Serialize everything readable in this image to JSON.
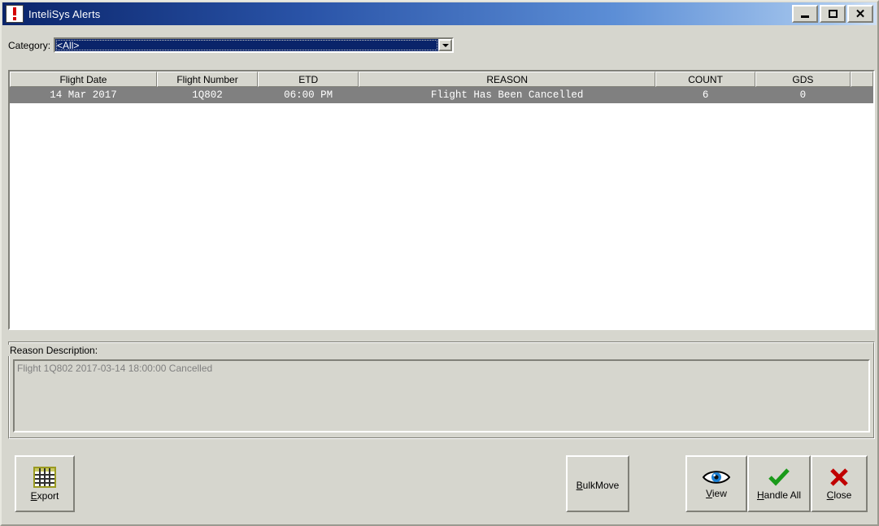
{
  "window": {
    "title": "InteliSys Alerts",
    "icon": "alert-exclamation-icon",
    "caption_buttons": {
      "minimize": "_",
      "maximize": "□",
      "close": "✕"
    }
  },
  "filter": {
    "category_label": "Category:",
    "category_value": "<All>",
    "category_options": [
      "<All>"
    ]
  },
  "grid": {
    "columns": [
      "Flight Date",
      "Flight Number",
      "ETD",
      "REASON",
      "COUNT",
      "GDS"
    ],
    "rows": [
      {
        "flight_date": "14 Mar 2017",
        "flight_number": "1Q802",
        "etd": "06:00 PM",
        "reason": "Flight Has Been Cancelled",
        "count": "6",
        "gds": "0",
        "selected": true
      }
    ]
  },
  "reason_panel": {
    "legend": "Reason Description:",
    "text": "Flight 1Q802 2017-03-14 18:00:00 Cancelled"
  },
  "buttons": {
    "export": {
      "label": "Export",
      "accel": "E",
      "icon": "spreadsheet-grid-icon"
    },
    "bulkmove": {
      "label": "BulkMove",
      "accel": "B"
    },
    "view": {
      "label": "View",
      "accel": "V",
      "icon": "eye-icon"
    },
    "handle_all": {
      "label": "Handle All",
      "accel": "H",
      "icon": "green-check-icon"
    },
    "close": {
      "label": "Close",
      "accel": "C",
      "icon": "red-x-icon"
    }
  },
  "colors": {
    "window_background": "#d6d6ce",
    "titlebar_start": "#0a246a",
    "titlebar_end": "#cfe0f5",
    "selection_row": "#808080",
    "combo_selection": "#0a246a",
    "disabled_text": "#808080",
    "accent_green": "#1a9a1a",
    "accent_red": "#c00000",
    "accent_blue": "#1a7fd4"
  }
}
